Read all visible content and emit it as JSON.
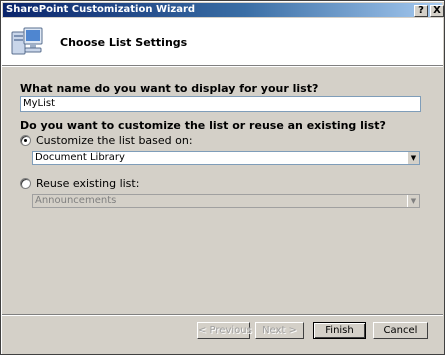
{
  "window": {
    "title": "SharePoint Customization Wizard",
    "help_glyph": "?",
    "close_glyph": "X"
  },
  "header": {
    "title": "Choose List Settings",
    "icon": "computer-icon"
  },
  "form": {
    "name_question": "What name do you want to display for your list?",
    "name_value": "MyList",
    "customize_question": "Do you want to customize the list or reuse an existing list?",
    "option_customize": {
      "label": "Customize the list based on:",
      "checked": true,
      "selected_value": "Document Library"
    },
    "option_reuse": {
      "label": "Reuse existing list:",
      "checked": false,
      "selected_value": "Announcements",
      "disabled": true
    }
  },
  "buttons": {
    "previous": "< Previous",
    "next": "Next >",
    "finish": "Finish",
    "cancel": "Cancel"
  },
  "arrow_glyph": "▼"
}
